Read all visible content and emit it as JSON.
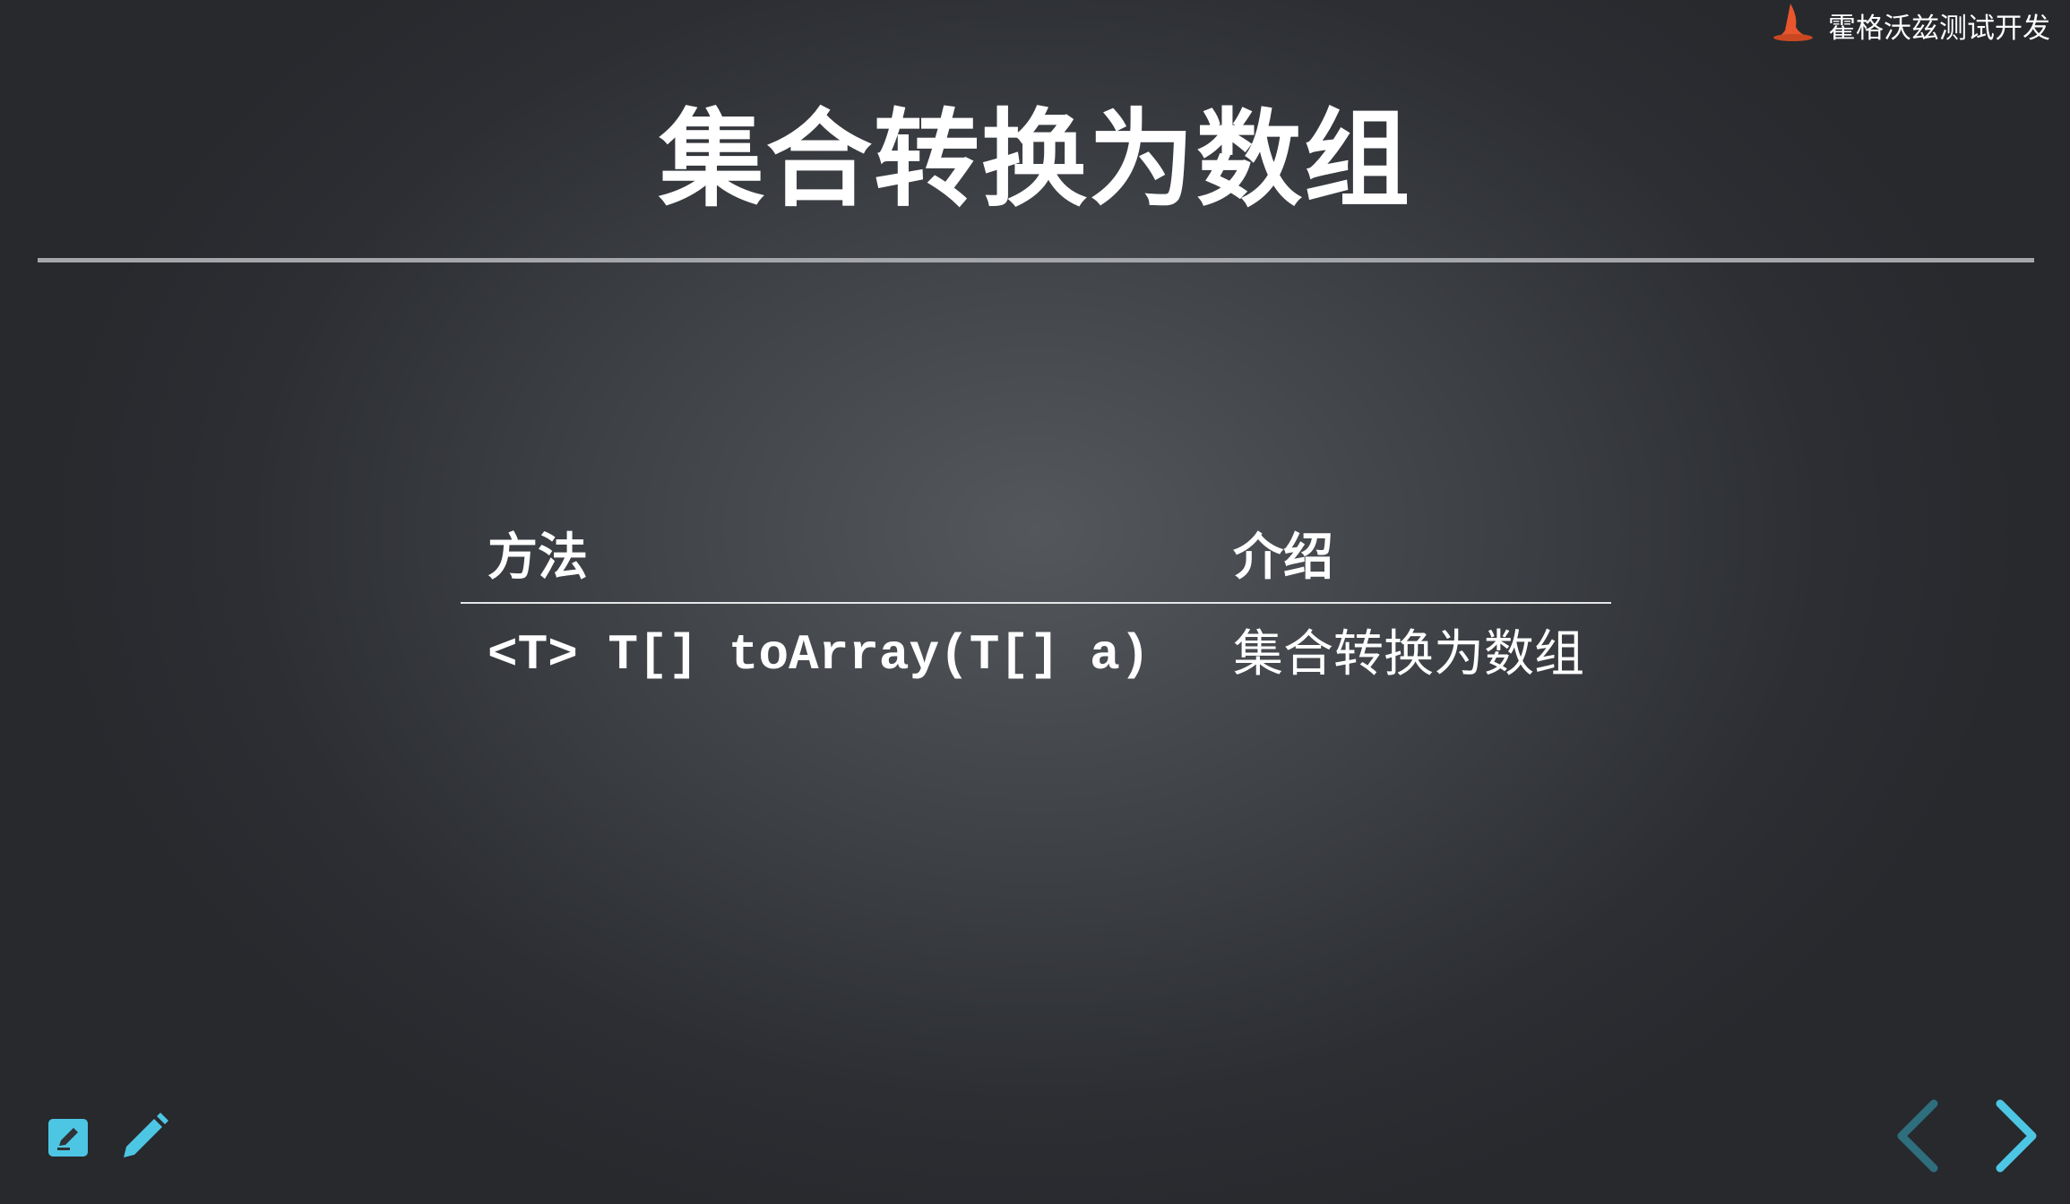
{
  "brand": {
    "name": "霍格沃兹测试开发",
    "logo_icon": "wizard-hat-icon",
    "logo_color": "#e8562d"
  },
  "slide": {
    "title": "集合转换为数组",
    "table": {
      "headers": [
        "方法",
        "介绍"
      ],
      "rows": [
        [
          "<T> T[] toArray(T[] a)",
          "集合转换为数组"
        ]
      ]
    }
  },
  "controls": {
    "edit_notes_icon": "edit-note-icon",
    "pen_icon": "pencil-icon",
    "prev_icon": "chevron-left-icon",
    "next_icon": "chevron-right-icon",
    "accent_color": "#4dc6e4"
  }
}
